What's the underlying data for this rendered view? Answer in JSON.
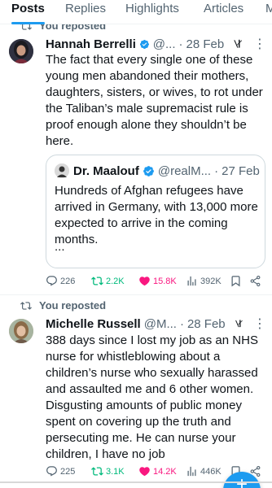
{
  "tabs": [
    {
      "label": "Posts",
      "active": true
    },
    {
      "label": "Replies",
      "active": false
    },
    {
      "label": "Highlights",
      "active": false
    },
    {
      "label": "Articles",
      "active": false
    },
    {
      "label": "M",
      "active": false
    }
  ],
  "posts": [
    {
      "repost_label": "You reposted",
      "name": "Hannah Berrelli",
      "handle": "@...",
      "date": "28 Feb",
      "text": "The fact that every single one of these young men abandoned their mothers, daughters, sisters, or wives, to rot under the Taliban’s male supremacist rule is proof enough alone they shouldn’t be here.",
      "quote": {
        "name": "Dr. Maalouf",
        "handle": "@realM...",
        "date": "27 Feb",
        "text": "Hundreds of Afghan refugees have arrived in Germany, with 13,000 more expected to arrive in the coming months.",
        "ellipsis": "..."
      },
      "replies": "226",
      "reposts": "2.2K",
      "likes": "15.8K",
      "views": "392K"
    },
    {
      "repost_label": "You reposted",
      "name": "Michelle Russell",
      "handle": "@M...",
      "date": "28 Feb",
      "text": "388 days since I lost my job as an NHS nurse for whistleblowing about a children’s nurse who sexually harassed and assaulted me and 6 other women. Disgusting amounts of public money spent on covering up the truth and persecuting me. He can nurse your children, I have no job",
      "replies": "225",
      "reposts": "3.1K",
      "likes": "14.2K",
      "views": "446K"
    }
  ],
  "colors": {
    "accent": "#1d9bf0",
    "repost": "#00ba7c",
    "like": "#f91880",
    "muted": "#536471"
  }
}
